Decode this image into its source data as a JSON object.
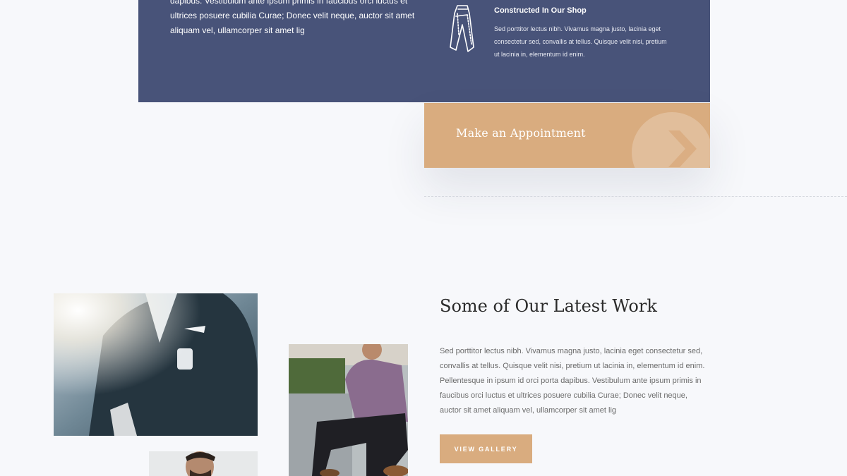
{
  "features": {
    "intro_lines": [
      "dapibus. Vestibulum ante ipsum primis in faucibus orci luctus et",
      "ultrices posuere cubilia Curae; Donec velit neque, auctor sit amet",
      "aliquam vel, ullamcorper sit amet lig"
    ],
    "item": {
      "icon": "trousers-icon",
      "title": "Constructed In Our Shop",
      "desc_lines": [
        "Sed porttitor lectus nibh. Vivamus magna justo, lacinia eget",
        "consectetur sed, convallis at tellus. Quisque velit nisi, pretium",
        "ut lacinia in, elementum id enim."
      ]
    }
  },
  "appointment": {
    "label": "Make an Appointment",
    "icon": "chevron-right-icon"
  },
  "latest_work": {
    "heading": "Some of Our Latest Work",
    "body_lines": [
      "Sed porttitor lectus nibh. Vivamus magna justo, lacinia eget consectetur sed,",
      "convallis at tellus. Quisque velit nisi, pretium ut lacinia in, elementum id enim.",
      "Pellentesque in ipsum id orci porta dapibus. Vestibulum ante ipsum primis in",
      "faucibus orci luctus et ultrices posuere cubilia Curae; Donec velit neque,",
      "auctor sit amet aliquam vel, ullamcorper sit amet lig"
    ],
    "button_label": "VIEW GALLERY"
  },
  "colors": {
    "navy": "#485379",
    "tan": "#d9ac7f",
    "background": "#f7f8fb",
    "heading_text": "#2b2b2b",
    "body_text": "#6b6b6b"
  }
}
